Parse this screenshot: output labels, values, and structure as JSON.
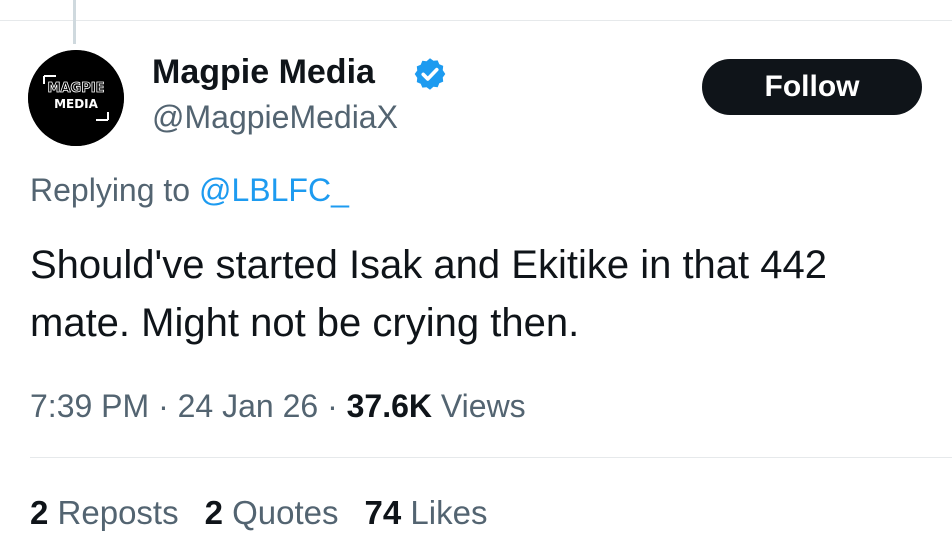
{
  "author": {
    "display_name": "Magpie Media",
    "handle": "@MagpieMediaX",
    "avatar_text_line1": "MAGPIE",
    "avatar_text_line2": "MEDIA",
    "verified": true
  },
  "follow_button": {
    "label": "Follow"
  },
  "reply": {
    "prefix": "Replying to",
    "mention": "@LBLFC_"
  },
  "tweet": {
    "line1": "Should've started Isak and Ekitike in that 442",
    "line2": "mate. Might not be crying then."
  },
  "meta": {
    "time": "7:39 PM",
    "sep1": "·",
    "date": "24 Jan 26",
    "sep2": "·",
    "views_count": "37.6K",
    "views_label": "Views"
  },
  "stats": {
    "reposts_count": "2",
    "reposts_label": "Reposts",
    "quotes_count": "2",
    "quotes_label": "Quotes",
    "likes_count": "74",
    "likes_label": "Likes"
  },
  "colors": {
    "accent": "#1d9bf0",
    "text_primary": "#0f1419",
    "text_secondary": "#536471",
    "button_bg": "#0f1419",
    "divider": "#e6e9eb"
  },
  "icons": {
    "verified": "verified-badge-icon"
  }
}
